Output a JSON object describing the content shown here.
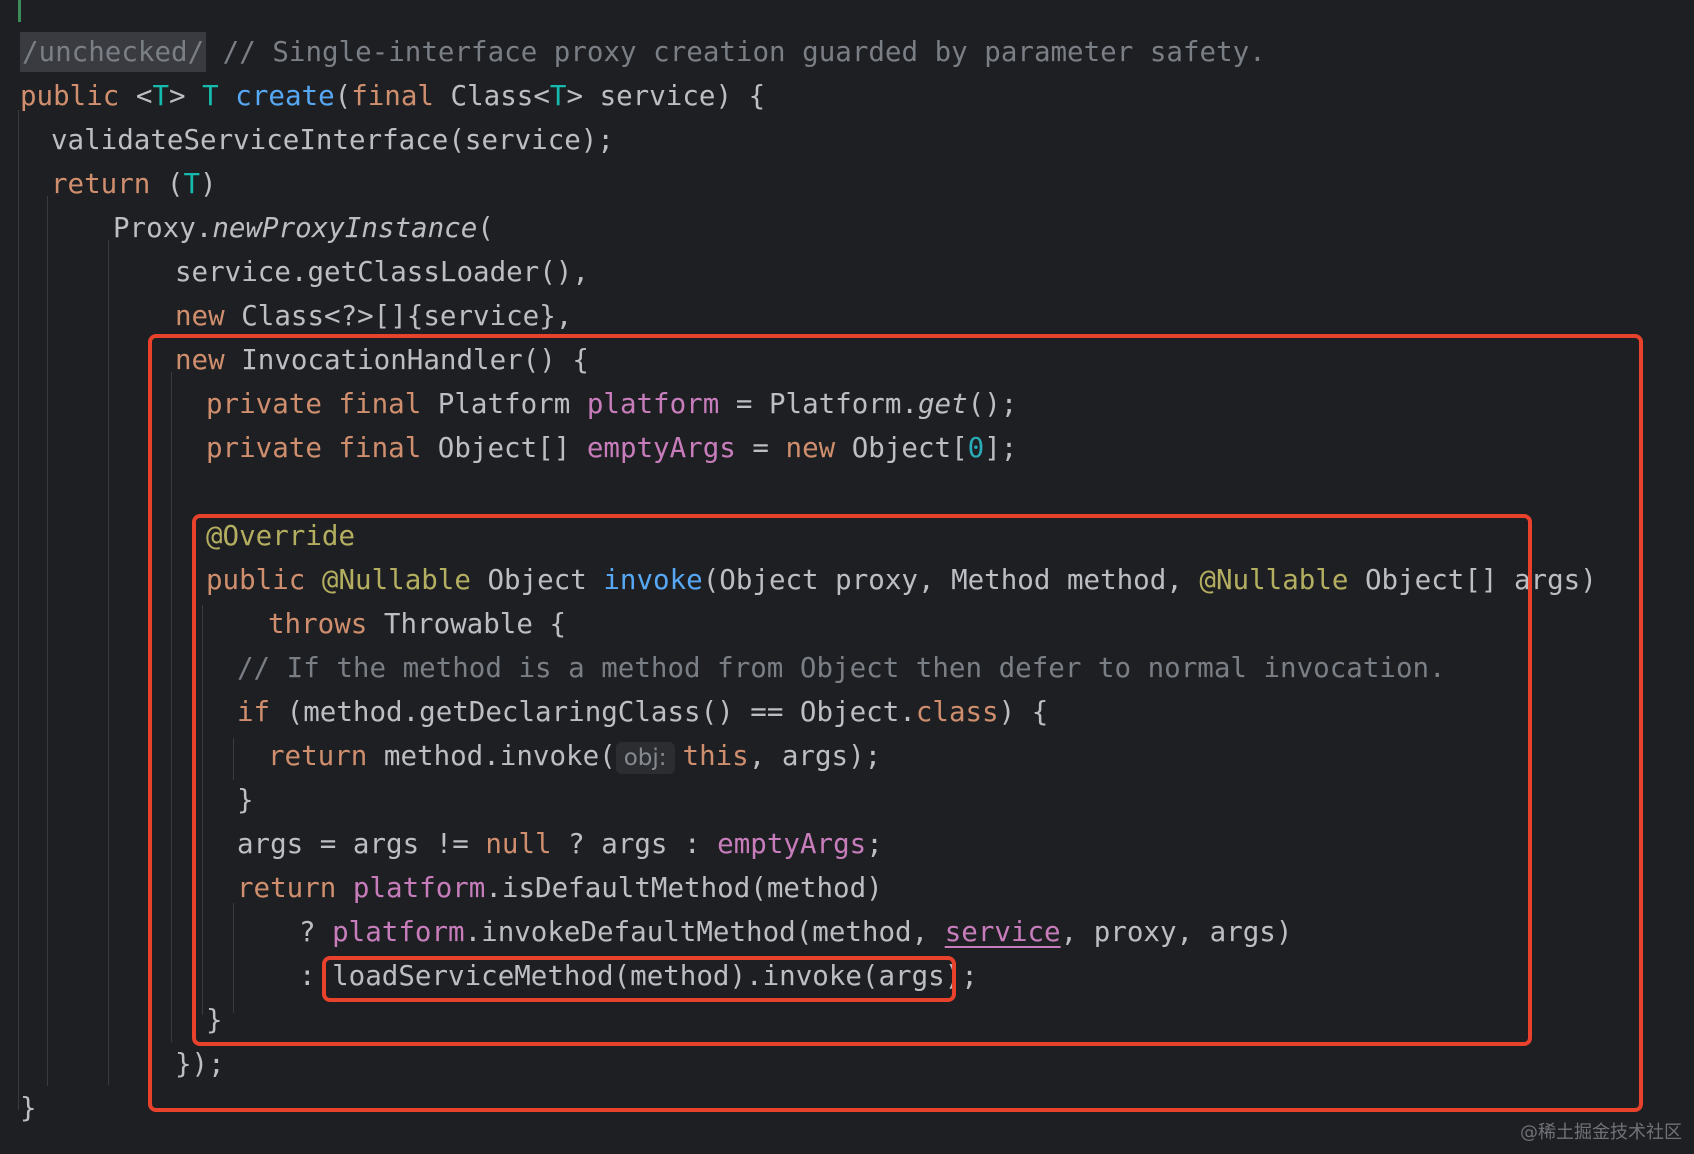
{
  "code": {
    "l1": {
      "unchecked": "/unchecked/",
      "comment": " // Single-interface proxy creation guarded by parameter safety."
    },
    "l2": {
      "public": "public",
      "typeparam": " <",
      "T1": "T",
      "gt": "> ",
      "T2": "T",
      "space": " ",
      "create": "create",
      "open": "(",
      "final": "final",
      "classT": " Class<",
      "T3": "T",
      "rest": "> service) {"
    },
    "l3": {
      "text": "validateServiceInterface(service);"
    },
    "l4": {
      "return": "return",
      "cast": " (",
      "T": "T",
      "close": ")"
    },
    "l5": {
      "proxy": "Proxy.",
      "method": "newProxyInstance",
      "paren": "("
    },
    "l6": {
      "text": "service.getClassLoader(),"
    },
    "l7": {
      "new": "new",
      "rest": " Class<?>[]{service},"
    },
    "l8": {
      "new": "new",
      "rest": " InvocationHandler() {"
    },
    "l9": {
      "private": "private",
      "final": " final",
      "type": " Platform ",
      "field": "platform",
      "eq": " = Platform.",
      "get": "get",
      "end": "();"
    },
    "l10": {
      "private": "private",
      "final": " final",
      "type": " Object[] ",
      "field": "emptyArgs",
      "eq": " = ",
      "new": "new",
      "obj": " Object[",
      "zero": "0",
      "end": "];"
    },
    "l12": {
      "override": "@Override"
    },
    "l13": {
      "public": "public",
      "sp": " ",
      "nullable1": "@Nullable",
      "obj": " Object ",
      "invoke": "invoke",
      "params1": "(Object proxy, Method method, ",
      "nullable2": "@Nullable",
      "params2": " Object[] args)"
    },
    "l14": {
      "throws": "throws",
      "rest": " Throwable {"
    },
    "l15": {
      "comment": "// If the method is a method from Object then defer to normal invocation."
    },
    "l16": {
      "if": "if",
      "mid": " (method.getDeclaringClass() == Object.",
      "class": "class",
      "end": ") {"
    },
    "l17": {
      "return": "return",
      "call": " method.invoke(",
      "hint": "obj:",
      "this": "this",
      "end": ", args);"
    },
    "l18": {
      "text": "}"
    },
    "l19": {
      "pre": "args = args != ",
      "null": "null",
      "mid": " ? args : ",
      "field": "emptyArgs",
      "end": ";"
    },
    "l20": {
      "return": "return",
      "sp": " ",
      "field": "platform",
      "end": ".isDefaultMethod(method)"
    },
    "l21": {
      "q": "? ",
      "field": "platform",
      "mid": ".invokeDefaultMethod(method, ",
      "service": "service",
      "end": ", proxy, args)"
    },
    "l22": {
      "colon": ": ",
      "text": "loadServiceMethod(method).invoke(args);"
    },
    "l23": {
      "text": "}"
    },
    "l24": {
      "text": "});"
    },
    "l25": {
      "text": "}"
    }
  },
  "watermark": "@稀土掘金技术社区",
  "colors": {
    "background": "#1e1f22",
    "keyword": "#cf8e6d",
    "type_param": "#16baac",
    "method_decl": "#56a8f5",
    "field": "#c77dbb",
    "annotation": "#b3ae60",
    "comment": "#7a7e85",
    "highlight_box": "#e8412c"
  }
}
